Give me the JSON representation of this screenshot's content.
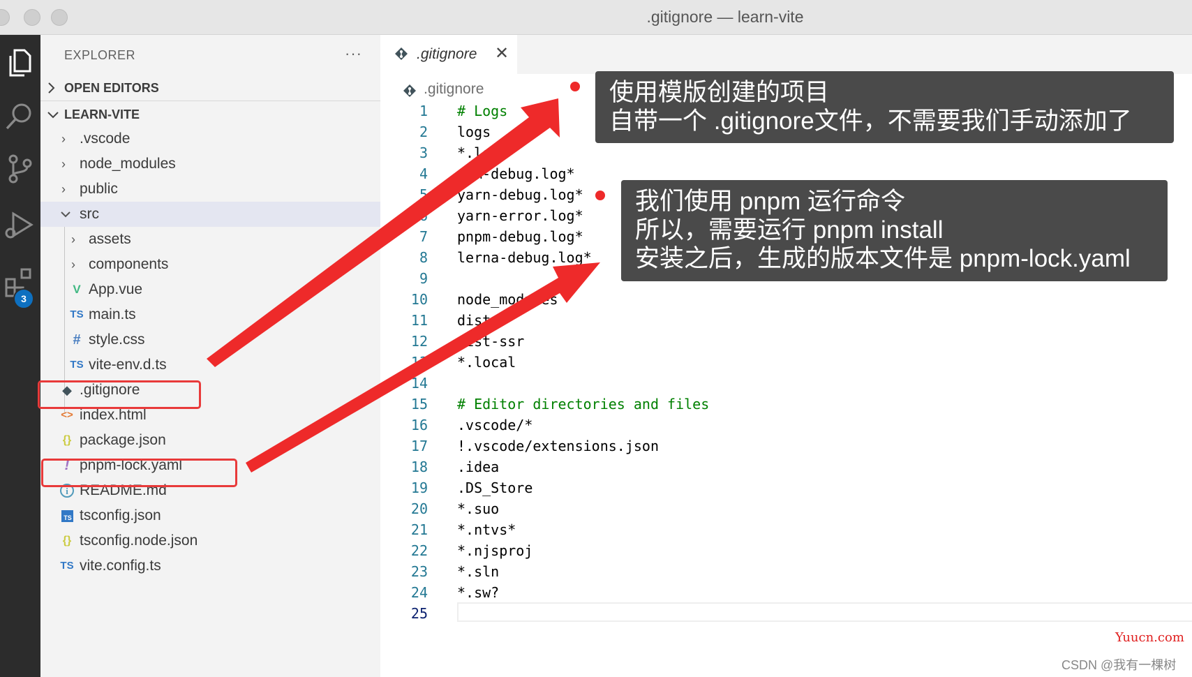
{
  "window": {
    "title": ".gitignore — learn-vite"
  },
  "activity_bar": {
    "items": [
      {
        "name": "explorer-icon"
      },
      {
        "name": "search-icon"
      },
      {
        "name": "source-control-icon"
      },
      {
        "name": "run-debug-icon"
      },
      {
        "name": "extensions-icon"
      }
    ],
    "extensions_badge": "3"
  },
  "explorer": {
    "title": "EXPLORER",
    "more": "···",
    "open_editors": "OPEN EDITORS",
    "project": "LEARN-VITE",
    "tree": [
      {
        "label": ".vscode",
        "type": "folder"
      },
      {
        "label": "node_modules",
        "type": "folder"
      },
      {
        "label": "public",
        "type": "folder"
      },
      {
        "label": "src",
        "type": "folder-open"
      },
      {
        "label": "assets",
        "type": "folder"
      },
      {
        "label": "components",
        "type": "folder"
      },
      {
        "label": "App.vue",
        "type": "vue",
        "icon": "V"
      },
      {
        "label": "main.ts",
        "type": "ts",
        "icon": "TS"
      },
      {
        "label": "style.css",
        "type": "css",
        "icon": "#"
      },
      {
        "label": "vite-env.d.ts",
        "type": "ts",
        "icon": "TS"
      },
      {
        "label": ".gitignore",
        "type": "git",
        "icon": "◆"
      },
      {
        "label": "index.html",
        "type": "html",
        "icon": "<>"
      },
      {
        "label": "package.json",
        "type": "json",
        "icon": "{}"
      },
      {
        "label": "pnpm-lock.yaml",
        "type": "yaml",
        "icon": "!"
      },
      {
        "label": "README.md",
        "type": "info",
        "icon": "i"
      },
      {
        "label": "tsconfig.json",
        "type": "tsconfig",
        "icon": "TS"
      },
      {
        "label": "tsconfig.node.json",
        "type": "json",
        "icon": "{}"
      },
      {
        "label": "vite.config.ts",
        "type": "ts",
        "icon": "TS"
      }
    ]
  },
  "editor": {
    "tab": {
      "label": ".gitignore",
      "close": "✕"
    },
    "breadcrumb": ".gitignore",
    "lines": [
      "# Logs",
      "logs",
      "*.log",
      "npm-debug.log*",
      "yarn-debug.log*",
      "yarn-error.log*",
      "pnpm-debug.log*",
      "lerna-debug.log*",
      "",
      "node_modules",
      "dist",
      "dist-ssr",
      "*.local",
      "",
      "# Editor directories and files",
      ".vscode/*",
      "!.vscode/extensions.json",
      ".idea",
      ".DS_Store",
      "*.suo",
      "*.ntvs*",
      "*.njsproj",
      "*.sln",
      "*.sw?",
      ""
    ],
    "current_line": 25
  },
  "annotations": {
    "callout1": [
      "使用模版创建的项目",
      "自带一个 .gitignore文件，不需要我们手动添加了"
    ],
    "callout2": [
      "我们使用 pnpm 运行命令",
      "所以，需要运行 pnpm install",
      "安装之后，生成的版本文件是 pnpm-lock.yaml"
    ],
    "accent": "#ee2a2a"
  },
  "watermarks": {
    "site": "Yuucn.com",
    "author": "CSDN @我有一棵树"
  }
}
